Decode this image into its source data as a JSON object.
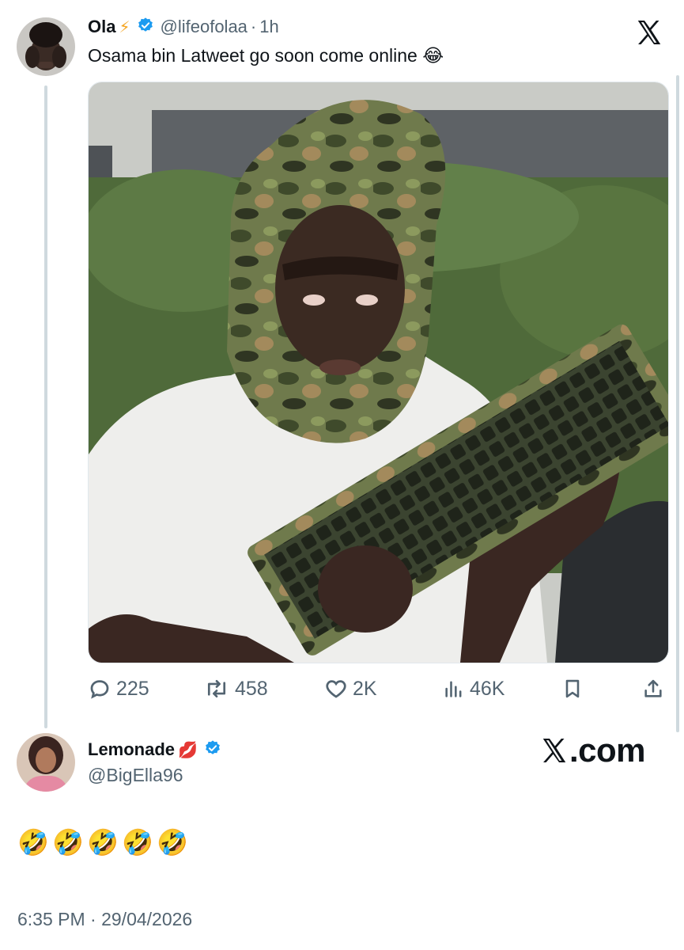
{
  "tweet": {
    "author_name": "Ola",
    "author_emoji": "⚡",
    "handle": "@lifeofolaa",
    "separator": "·",
    "time_ago": "1h",
    "text": "Osama bin Latweet go soon come online",
    "text_emoji": "😂",
    "stats": {
      "replies": "225",
      "reposts": "458",
      "likes": "2K",
      "views": "46K"
    }
  },
  "reply": {
    "author_name": "Lemonade",
    "author_emoji": "💋",
    "handle": "@BigElla96",
    "emojis": [
      "🤣",
      "🤣",
      "🤣",
      "🤣",
      "🤣"
    ],
    "timestamp": "6:35 PM · 29/04/2026"
  },
  "watermark": {
    "text": ".com"
  },
  "icons": {
    "top_logo": "x-logo-icon",
    "watermark_logo": "x-logo-icon"
  },
  "colors": {
    "verified_blue": "#1d9bf0",
    "muted_text": "#536471",
    "thread_line": "#cfd9de"
  }
}
